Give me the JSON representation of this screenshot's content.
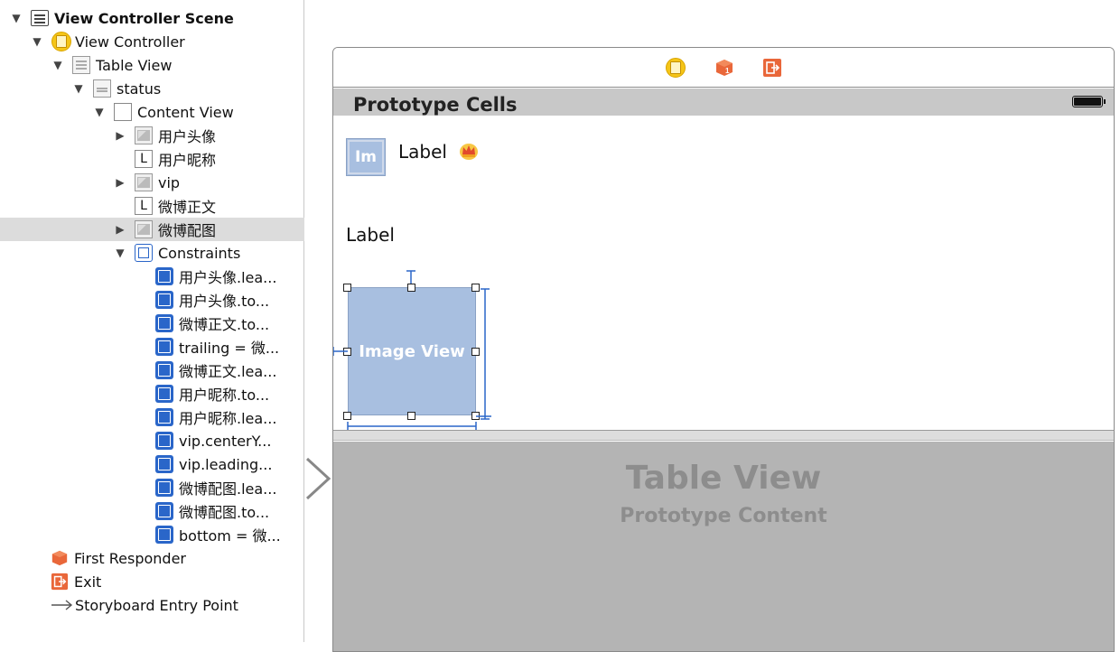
{
  "outline": {
    "items": [
      {
        "label": "View Controller Scene",
        "icon": "scene-icon",
        "disclosure": "open",
        "bold": true
      },
      {
        "label": "View Controller",
        "icon": "view-controller-icon",
        "disclosure": "open"
      },
      {
        "label": "Table View",
        "icon": "table-view-icon",
        "disclosure": "open"
      },
      {
        "label": "status",
        "icon": "table-cell-icon",
        "disclosure": "open"
      },
      {
        "label": "Content View",
        "icon": "view-icon",
        "disclosure": "open"
      },
      {
        "label": "用户头像",
        "icon": "image-view-icon",
        "disclosure": "closed"
      },
      {
        "label": "用户昵称",
        "icon": "label-icon",
        "icon_text": "L",
        "disclosure": "none"
      },
      {
        "label": "vip",
        "icon": "image-view-icon",
        "disclosure": "closed"
      },
      {
        "label": "微博正文",
        "icon": "label-icon",
        "icon_text": "L",
        "disclosure": "none"
      },
      {
        "label": "微博配图",
        "icon": "image-view-icon",
        "disclosure": "closed",
        "selected": true
      },
      {
        "label": "Constraints",
        "icon": "constraints-icon",
        "disclosure": "open"
      },
      {
        "label": "用户头像.lea...",
        "icon": "constraint-icon",
        "disclosure": "none"
      },
      {
        "label": "用户头像.to...",
        "icon": "constraint-icon",
        "disclosure": "none"
      },
      {
        "label": "微博正文.to...",
        "icon": "constraint-icon",
        "disclosure": "none"
      },
      {
        "label": "trailing = 微...",
        "icon": "constraint-icon",
        "disclosure": "none"
      },
      {
        "label": "微博正文.lea...",
        "icon": "constraint-icon",
        "disclosure": "none"
      },
      {
        "label": "用户昵称.to...",
        "icon": "constraint-icon",
        "disclosure": "none"
      },
      {
        "label": "用户昵称.lea...",
        "icon": "constraint-icon",
        "disclosure": "none"
      },
      {
        "label": "vip.centerY...",
        "icon": "constraint-icon",
        "disclosure": "none"
      },
      {
        "label": "vip.leading...",
        "icon": "constraint-icon",
        "disclosure": "none"
      },
      {
        "label": "微博配图.lea...",
        "icon": "constraint-icon",
        "disclosure": "none"
      },
      {
        "label": "微博配图.to...",
        "icon": "constraint-icon",
        "disclosure": "none"
      },
      {
        "label": "bottom = 微...",
        "icon": "constraint-icon",
        "disclosure": "none"
      },
      {
        "label": "First Responder",
        "icon": "first-responder-icon",
        "icon_text": "1",
        "disclosure": "none"
      },
      {
        "label": "Exit",
        "icon": "exit-icon",
        "icon_text": "→",
        "disclosure": "none"
      },
      {
        "label": "Storyboard Entry Point",
        "icon": "entry-arrow-icon",
        "disclosure": "none"
      }
    ]
  },
  "canvas": {
    "scene_bar_icons": [
      "view-controller-icon",
      "first-responder-icon",
      "exit-icon"
    ],
    "prototype_header": "Prototype Cells",
    "cell": {
      "avatar_text": "Im",
      "nickname_label": "Label",
      "vip_icon": "crown-icon",
      "text_label": "Label",
      "image_view_text": "Image View"
    },
    "table_view_title": "Table View",
    "table_view_subtitle": "Prototype Content"
  },
  "colors": {
    "accent_blue": "#2a66c9",
    "image_placeholder": "#a8bfe0",
    "responder_orange": "#e9673a",
    "vc_yellow": "#f5c518",
    "selection_gray": "#dcdcdc",
    "table_area_gray": "#b4b4b4"
  }
}
